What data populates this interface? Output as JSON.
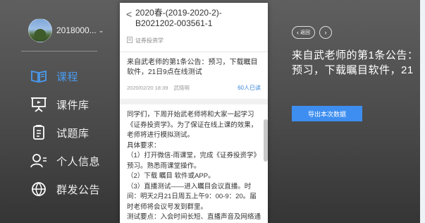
{
  "user": {
    "name": "2018000...",
    "caret": "⌄"
  },
  "nav": [
    {
      "label": "课程",
      "icon": "course-icon"
    },
    {
      "label": "课件库",
      "icon": "courseware-icon"
    },
    {
      "label": "试题库",
      "icon": "question-bank-icon"
    },
    {
      "label": "个人信息",
      "icon": "personal-info-icon"
    },
    {
      "label": "群发公告",
      "icon": "broadcast-icon"
    }
  ],
  "panel": {
    "back_glyph": "<",
    "course_title": "2020春-(2019-2020-2)-B2021202-003561-1",
    "course_tag": "证券投资学",
    "notice_title": "来自武老师的第1条公告：预习，下载瞩目软件，21日9点在线测试",
    "date": "2020/02/20 18:39",
    "author": "武晓明",
    "read_count": "60人已读",
    "body": "同学们，下周开始武老师将和大家一起学习《证券投资学》。为了保证在线上课的效果，老师将进行模拟测试。\n具体要求：\n（1）打开微信-雨课堂，完成《证券投资学》预习。熟悉雨课堂操作。\n（2）下载 瞩目 软件或APP。\n（3）直播测试——进入瞩目会议直播。时间：明天2月21日周五上午9：00-9：20。届时老师将会议号发到群里。\n测试要点：入会时间长短、直播声音及网络通畅效果、上课体验。"
  },
  "right": {
    "back_label": "返回",
    "preview_title": "来自武老师的第1条公告：预习，下载瞩目软件，21",
    "export_label": "导出本次数据"
  },
  "colors": {
    "accent": "#3d8ef0",
    "active_nav": "#4a9bf0",
    "read": "#3a86d9"
  }
}
